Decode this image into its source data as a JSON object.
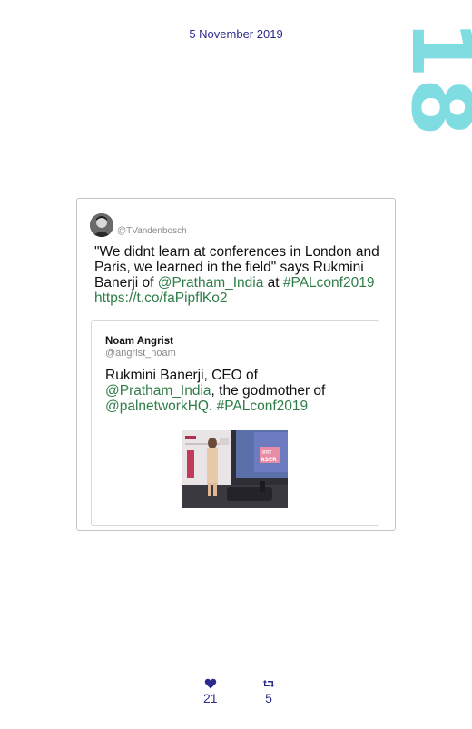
{
  "header": {
    "date": "5 November 2019",
    "page_number": "18"
  },
  "tweet": {
    "handle": "@TVandenbosch",
    "text_parts": [
      "\"We didnt learn at conferences in London and Paris, we learned in the field\" says Rukmini Banerji of ",
      "@Pratham_India",
      " at ",
      "#PALconf2019",
      " ",
      "https://t.co/faPipflKo2"
    ],
    "quoted": {
      "name": "Noam Angrist",
      "handle": "@angrist_noam",
      "text_parts": [
        "Rukmini Banerji, CEO of ",
        "@Pratham_India",
        ", the godmother of ",
        "@palnetworkHQ",
        ". ",
        "#PALconf2019"
      ],
      "photo_caption_text": [
        "असर",
        "ASER"
      ]
    }
  },
  "stats": {
    "likes": "21",
    "retweets": "5"
  },
  "colors": {
    "link": "#2e7d48",
    "accent": "#2b2b8c",
    "page_number": "#7fdde2"
  },
  "icons": {
    "like": "heart-icon",
    "retweet": "retweet-icon"
  }
}
